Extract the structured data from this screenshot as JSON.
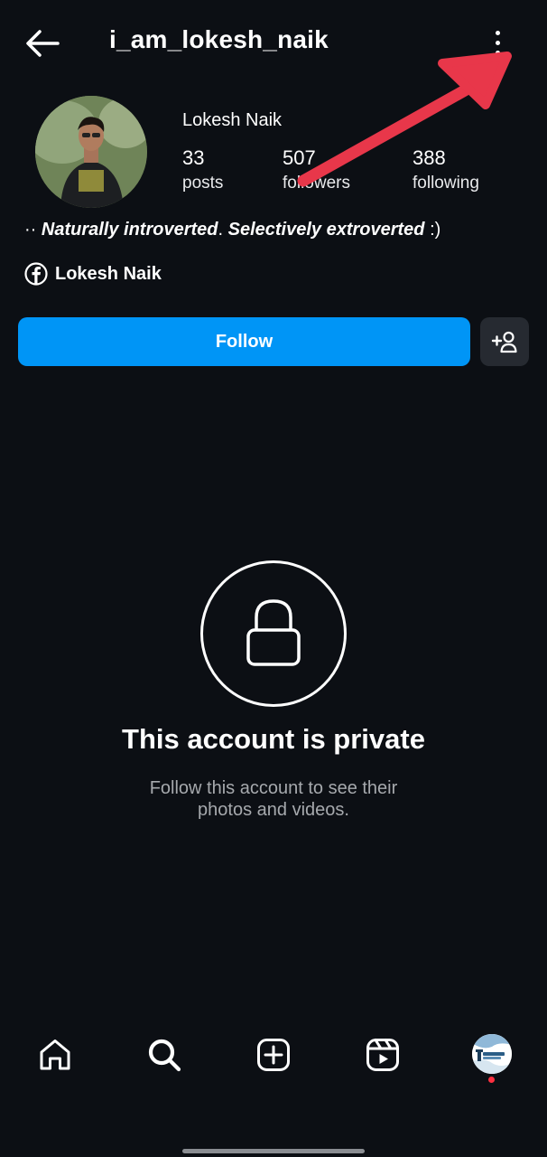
{
  "header": {
    "username": "i_am_lokesh_naik"
  },
  "profile": {
    "display_name": "Lokesh Naik",
    "stats": [
      {
        "value": "33",
        "label": "posts"
      },
      {
        "value": "507",
        "label": "followers"
      },
      {
        "value": "388",
        "label": "following"
      }
    ],
    "bio_prefix": "·· ",
    "bio_part1": "Naturally introverted",
    "bio_sep": ". ",
    "bio_part2": "Selectively extroverted",
    "bio_suffix": " :)",
    "facebook_link": "Lokesh Naik"
  },
  "actions": {
    "follow_label": "Follow"
  },
  "private": {
    "title": "This account is private",
    "subtitle_line1": "Follow this account to see their",
    "subtitle_line2": "photos and videos."
  },
  "colors": {
    "background": "#0c0f14",
    "follow_button": "#0095f6",
    "secondary_button": "#262a31",
    "annotation_arrow": "#e8374a",
    "notification_dot": "#ff3040"
  },
  "icons": {
    "back": "arrow-left-icon",
    "menu": "more-vertical-icon",
    "facebook": "facebook-icon",
    "suggest": "add-person-icon",
    "lock": "lock-icon",
    "nav": [
      "home-icon",
      "search-icon",
      "create-icon",
      "reels-icon",
      "profile-avatar"
    ]
  }
}
